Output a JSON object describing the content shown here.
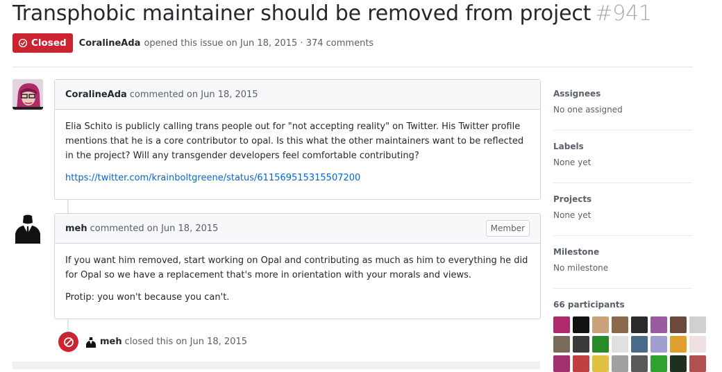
{
  "issue": {
    "title": "Transphobic maintainer should be removed from project",
    "number": "#941",
    "state": "Closed",
    "author": "CoralineAda",
    "meta_text": "opened this issue on Jun 18, 2015 · 374 comments"
  },
  "comments": [
    {
      "author": "CoralineAda",
      "action": "commented on Jun 18, 2015",
      "paragraphs": [
        "Elia Schito is publicly calling trans people out for \"not accepting reality\" on Twitter. His Twitter profile mentions that he is a core contributor to opal. Is this what the other maintainers want to be reflected in the project? Will any transgender developers feel comfortable contributing?"
      ],
      "link": "https://twitter.com/krainboltgreene/status/611569515315507200"
    },
    {
      "author": "meh",
      "action": "commented on Jun 18, 2015",
      "badge": "Member",
      "paragraphs": [
        "If you want him removed, start working on Opal and contributing as much as him to everything he did for Opal so we have a replacement that's more in orientation with your morals and views.",
        "Protip: you won't because you can't."
      ]
    }
  ],
  "event": {
    "actor": "meh",
    "text": "closed this on Jun 18, 2015"
  },
  "sidebar": {
    "assignees": {
      "title": "Assignees",
      "value": "No one assigned"
    },
    "labels": {
      "title": "Labels",
      "value": "None yet"
    },
    "projects": {
      "title": "Projects",
      "value": "None yet"
    },
    "milestone": {
      "title": "Milestone",
      "value": "No milestone"
    },
    "participants": {
      "title": "66 participants"
    }
  },
  "colors": {
    "closed": "#cb2431",
    "link": "#0366d6"
  }
}
